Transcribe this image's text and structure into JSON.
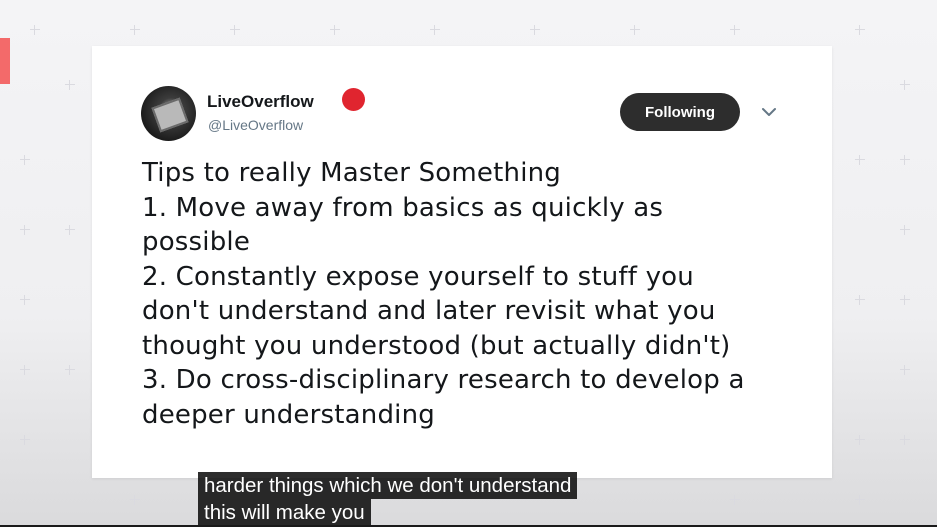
{
  "tweet": {
    "display_name": "LiveOverflow",
    "handle": "@LiveOverflow",
    "follow_button": "Following",
    "text_lines": [
      "Tips to really Master Something",
      "1. Move away from basics as quickly as",
      "possible",
      "2. Constantly expose yourself to stuff you",
      "don't understand and later revisit what you",
      "thought you understood (but actually didn't)",
      "3. Do cross-disciplinary research to develop a",
      "deeper understanding"
    ]
  },
  "captions": {
    "line1": "harder things which we don't understand",
    "line2": "this will make you"
  },
  "icons": {
    "avatar": "avatar-image",
    "badge": "red-circle-icon",
    "menu": "chevron-down-icon"
  },
  "colors": {
    "badge": "#e0252f",
    "button_bg": "#2d2d2d",
    "accent_tab": "#f36a6a"
  }
}
